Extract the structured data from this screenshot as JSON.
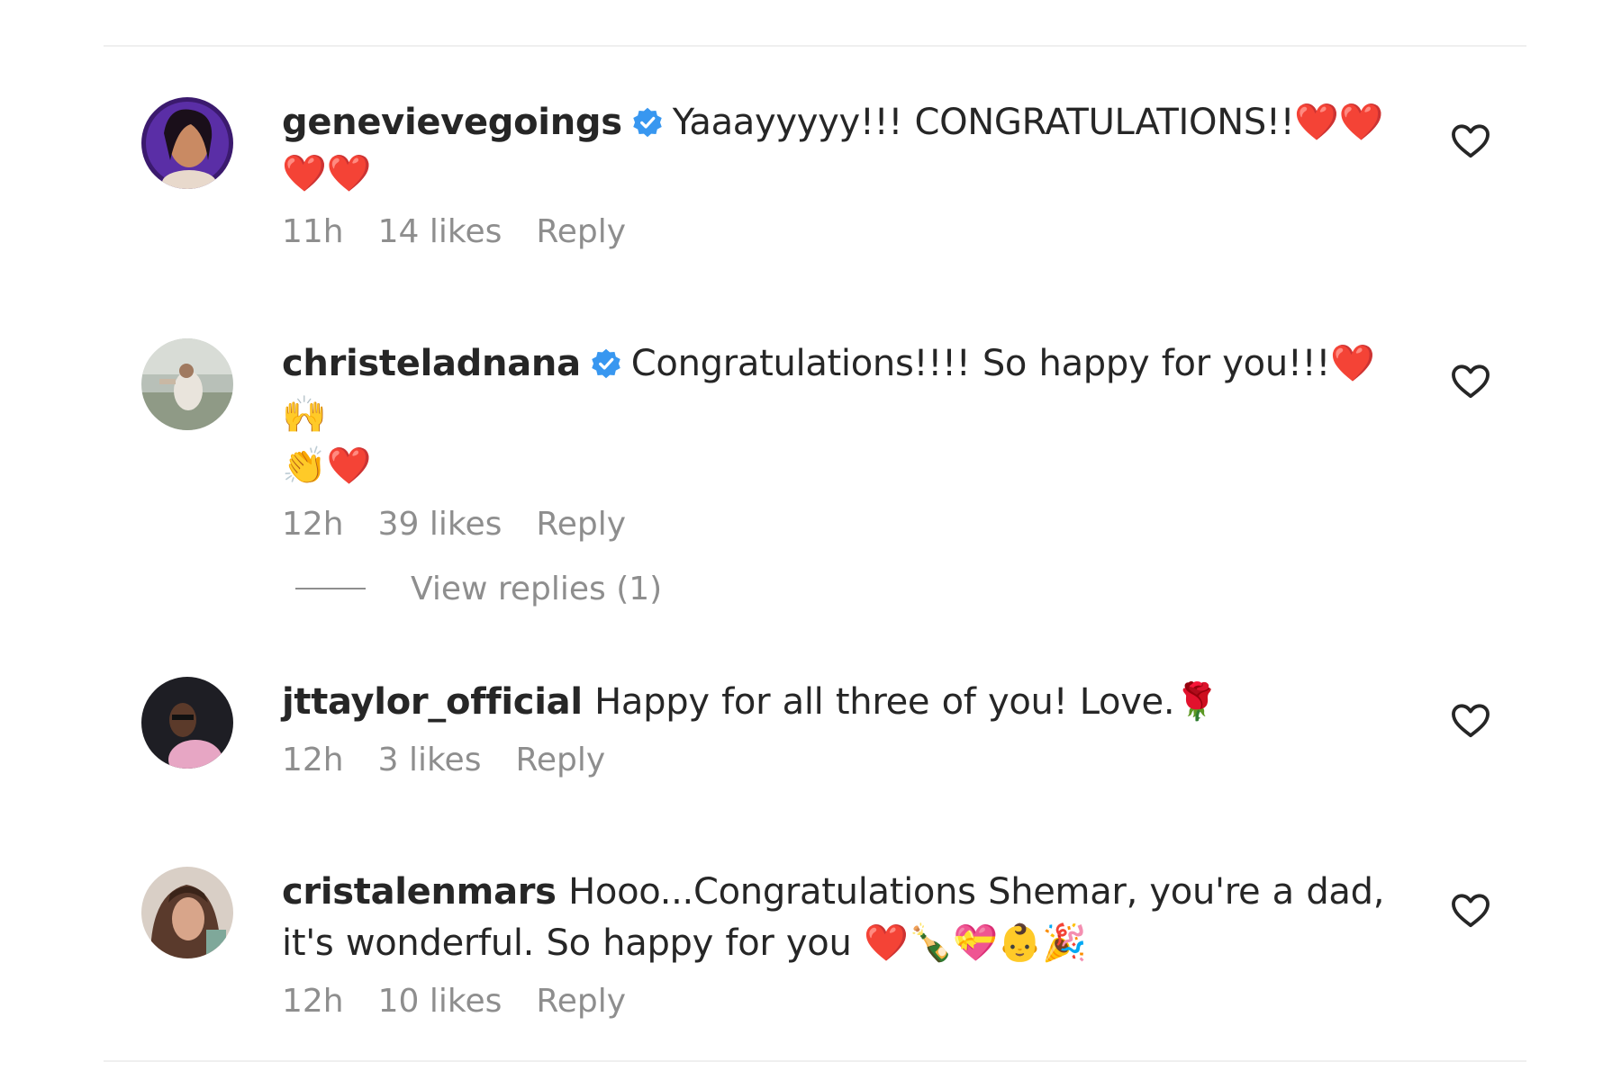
{
  "comments": [
    {
      "username": "genevievegoings",
      "verified": true,
      "text": "Yaaayyyyy!!! CONGRATULATIONS!!",
      "emojis_inline": "❤️❤️",
      "emojis_wrap": "❤️❤️",
      "time": "11h",
      "likes": "14 likes",
      "reply": "Reply",
      "avatar_color": "#3b1a6e"
    },
    {
      "username": "christeladnana",
      "verified": true,
      "text": "Congratulations!!!! So happy for you!!!",
      "emojis_inline": "❤️🙌",
      "emojis_wrap": "👏❤️",
      "time": "12h",
      "likes": "39 likes",
      "reply": "Reply",
      "avatar_color": "#9aa09a"
    },
    {
      "username": "jttaylor_official",
      "verified": false,
      "text": "Happy for all three of you! Love.",
      "emojis_inline": "🌹",
      "emojis_wrap": "",
      "time": "12h",
      "likes": "3 likes",
      "reply": "Reply",
      "avatar_color": "#1e1e24"
    },
    {
      "username": "cristalenmars",
      "verified": false,
      "text": "Hooo...Congratulations Shemar, you're a dad, it's wonderful. So happy for you",
      "emojis_inline": "❤️🍾💝👶🎉",
      "emojis_wrap": "",
      "time": "12h",
      "likes": "10 likes",
      "reply": "Reply",
      "avatar_color": "#6b4a3a"
    }
  ],
  "view_replies": "View replies (1)",
  "icons": {
    "verified": "verified-badge-icon",
    "like": "heart-outline-icon"
  },
  "colors": {
    "verified_blue": "#3897f0",
    "meta_gray": "#8e8e8e",
    "text": "#262626"
  }
}
